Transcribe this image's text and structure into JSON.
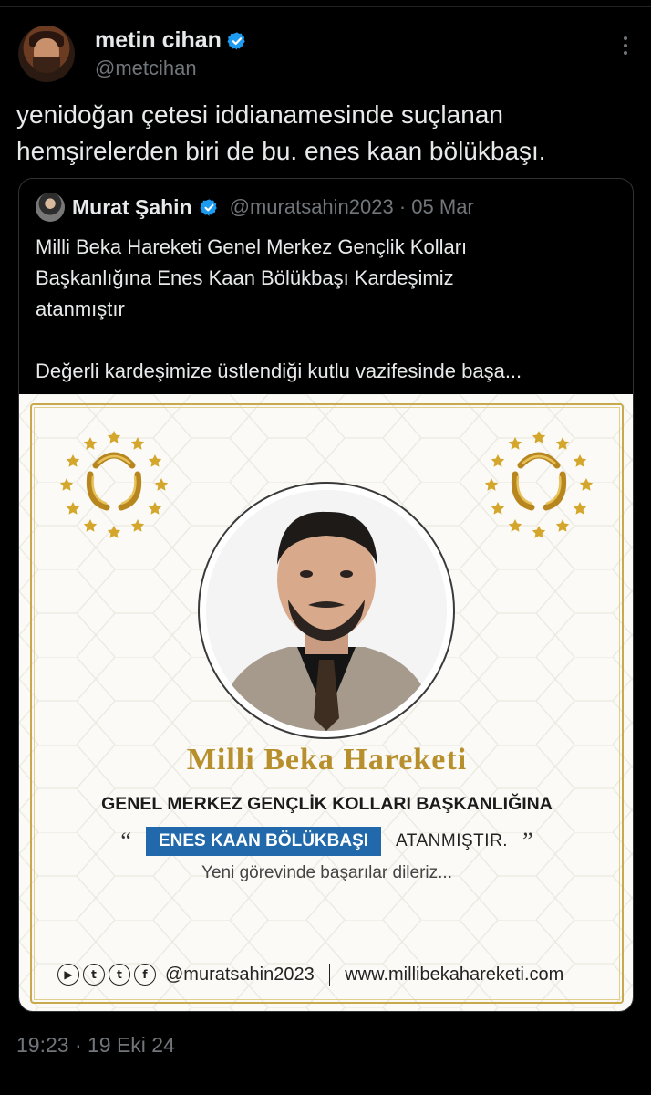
{
  "author": {
    "name": "metin cihan",
    "handle": "@metcihan"
  },
  "tweet": {
    "text_line1": "yenidoğan çetesi iddianamesinde suçlanan",
    "text_line2": "hemşirelerden biri de bu. enes kaan bölükbaşı.",
    "timestamp": "19:23 · 19 Eki 24"
  },
  "quoted": {
    "name": "Murat Şahin",
    "meta": "@muratsahin2023 · 05 Mar",
    "line1": "Milli Beka Hareketi Genel Merkez Gençlik Kolları",
    "line2": "Başkanlığına Enes Kaan Bölükbaşı Kardeşimiz",
    "line3": "atanmıştır",
    "line4": "Değerli kardeşimize üstlendiği kutlu vazifesinde başa..."
  },
  "poster": {
    "title": "Milli Beka Hareketi",
    "subheading": "GENEL MERKEZ GENÇLİK KOLLARI BAŞKANLIĞINA",
    "open_quote": "“",
    "appointee": "ENES KAAN BÖLÜKBAŞI",
    "appointed": "ATANMIŞTIR.",
    "close_quote": "”",
    "wish": "Yeni görevinde başarılar dileriz...",
    "social_icons": [
      "youtube-icon",
      "twitter-icon",
      "tumblr-icon",
      "facebook-icon"
    ],
    "social_handle": "@muratsahin2023",
    "website": "www.millibekahareketi.com"
  },
  "colors": {
    "verified": "#1d9bf0",
    "gold": "#b78f2c",
    "name_box": "#2169aa",
    "muted": "#71767b"
  }
}
